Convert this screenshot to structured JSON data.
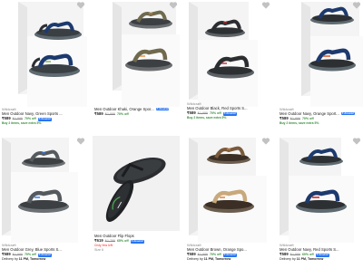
{
  "products": [
    {
      "brand": "Wildcraft",
      "title": "Men Outdoor Navy, Green Sports ...",
      "price": "₹589",
      "mrp": "₹1,999",
      "off": "70% off",
      "offer": "Buy 2 items, save extra 5%",
      "assured": "F-Assured"
    },
    {
      "brand": "",
      "title": "Men Outdoor Khaki, Orange Spor...",
      "price": "₹589",
      "mrp": "₹1,999",
      "off": "70% off",
      "offer": "",
      "assured": "F-Assured"
    },
    {
      "brand": "Wildcraft",
      "title": "Men Outdoor Black, Red Sports S...",
      "price": "₹589",
      "mrp": "₹1,999",
      "off": "70% off",
      "offer": "Buy 2 items, save extra 5%",
      "assured": "F-Assured"
    },
    {
      "brand": "Wildcraft",
      "title": "Men Outdoor Navy, Orange Sport...",
      "price": "₹589",
      "mrp": "₹1,999",
      "off": "70% off",
      "offer": "Buy 2 items, save extra 5%",
      "assured": "F-Assured"
    },
    {
      "brand": "Wildcraft",
      "title": "Men Outdoor Grey, Blue Sports S...",
      "price": "₹589",
      "mrp": "₹1,999",
      "off": "70% off",
      "delivery_prefix": "Delivery by",
      "delivery_date": "11 PM, Tomorrow",
      "assured": "F-Assured"
    },
    {
      "brand": "",
      "title": "Men Outdoor Flip Flops",
      "price": "₹619",
      "mrp": "₹1,799",
      "off": "65% off",
      "fewleft": "Only few left",
      "size": "Size 6",
      "assured": "F-Assured"
    },
    {
      "brand": "Wildcraft",
      "title": "Men Outdoor Brown, Orange Spo...",
      "price": "₹589",
      "mrp": "₹1,999",
      "off": "70% off",
      "delivery_prefix": "Delivery by",
      "delivery_date": "11 PM, Tomorrow",
      "assured": "F-Assured"
    },
    {
      "brand": "Wildcraft",
      "title": "Men Outdoor Navy, Red Sports S...",
      "price": "₹589",
      "mrp": "₹1,999",
      "off": "60% off",
      "delivery_prefix": "Delivery by",
      "delivery_date": "11 PM, Tomorrow",
      "assured": "F-Assured"
    }
  ],
  "colors": {
    "assured": "#2874f0",
    "offer": "#388e3c",
    "muted": "#878787",
    "fewleft": "#ff6161"
  },
  "icons": {
    "wishlist": "heart-icon",
    "assured": "flipkart-assured-badge"
  }
}
